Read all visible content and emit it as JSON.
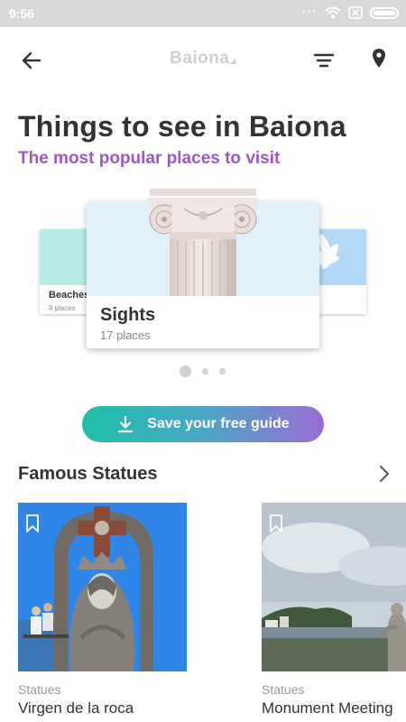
{
  "status_bar": {
    "time": "9:56",
    "icons": [
      "dots-icon",
      "wifi-icon",
      "sim-off-icon",
      "battery-icon"
    ]
  },
  "app_bar": {
    "logo_text": "Baiona",
    "icons": [
      "back-arrow-icon",
      "filter-icon",
      "map-pin-icon"
    ]
  },
  "header": {
    "title": "Things to see in Baiona",
    "subtitle": "The most popular places to visit"
  },
  "carousel": {
    "cards": [
      {
        "name": "Beaches",
        "count": "9 places"
      },
      {
        "name": "Sights",
        "count": "17 places"
      }
    ],
    "pages": 3,
    "active_page": 1
  },
  "save_button": {
    "label": "Save your free guide",
    "icon": "download-icon"
  },
  "section": {
    "title": "Famous Statues",
    "items": [
      {
        "category": "Statues",
        "name": "Virgen de la roca"
      },
      {
        "category": "Statues",
        "name": "Monument Meeting"
      }
    ]
  },
  "colors": {
    "accent_purple": "#9b59c8",
    "gradient_start": "#1fbfa6",
    "gradient_end": "#9a6cd3",
    "status_bar": "#d9d9d9"
  }
}
